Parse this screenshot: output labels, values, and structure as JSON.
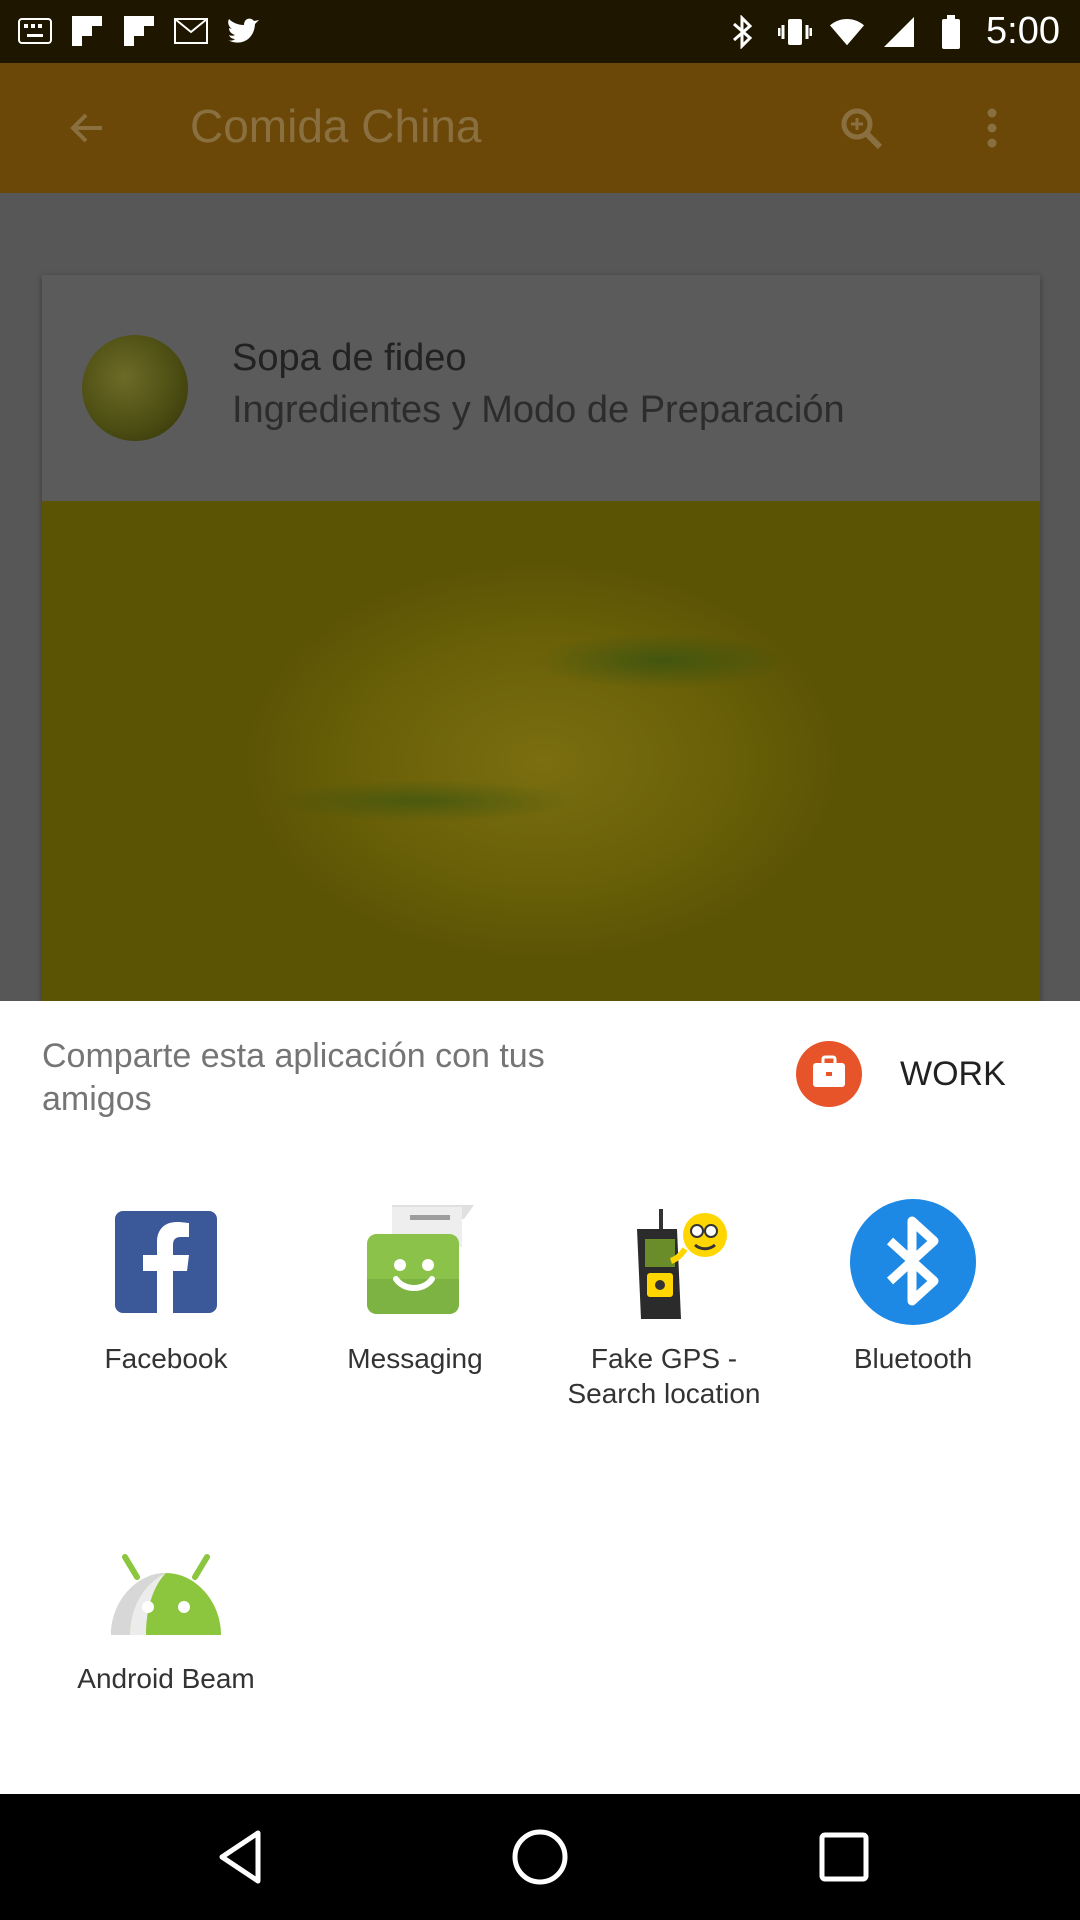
{
  "status_bar": {
    "time": "5:00",
    "left_icons": [
      "keyboard-icon",
      "flipboard-icon",
      "flipboard-icon",
      "mail-icon",
      "twitter-icon"
    ],
    "right_icons": [
      "bluetooth-icon",
      "vibrate-icon",
      "wifi-icon",
      "signal-icon",
      "battery-icon"
    ]
  },
  "app_bar": {
    "title": "Comida China",
    "color": "#6b4807"
  },
  "card": {
    "title": "Sopa de fideo",
    "subtitle": "Ingredientes y Modo de Preparación"
  },
  "share_sheet": {
    "heading": "Comparte esta aplicación con tus amigos",
    "work_label": "WORK",
    "apps": [
      {
        "label": "Facebook",
        "icon": "facebook-icon"
      },
      {
        "label": "Messaging",
        "icon": "messaging-icon"
      },
      {
        "label": "Fake GPS - Search location",
        "icon": "fake-gps-icon"
      },
      {
        "label": "Bluetooth",
        "icon": "bluetooth-icon"
      },
      {
        "label": "Android Beam",
        "icon": "android-beam-icon"
      }
    ]
  },
  "colors": {
    "facebook": "#3b5998",
    "messaging": "#8bc34a",
    "bluetooth": "#1e88e5",
    "android": "#8cc63f",
    "work": "#e8542a"
  }
}
